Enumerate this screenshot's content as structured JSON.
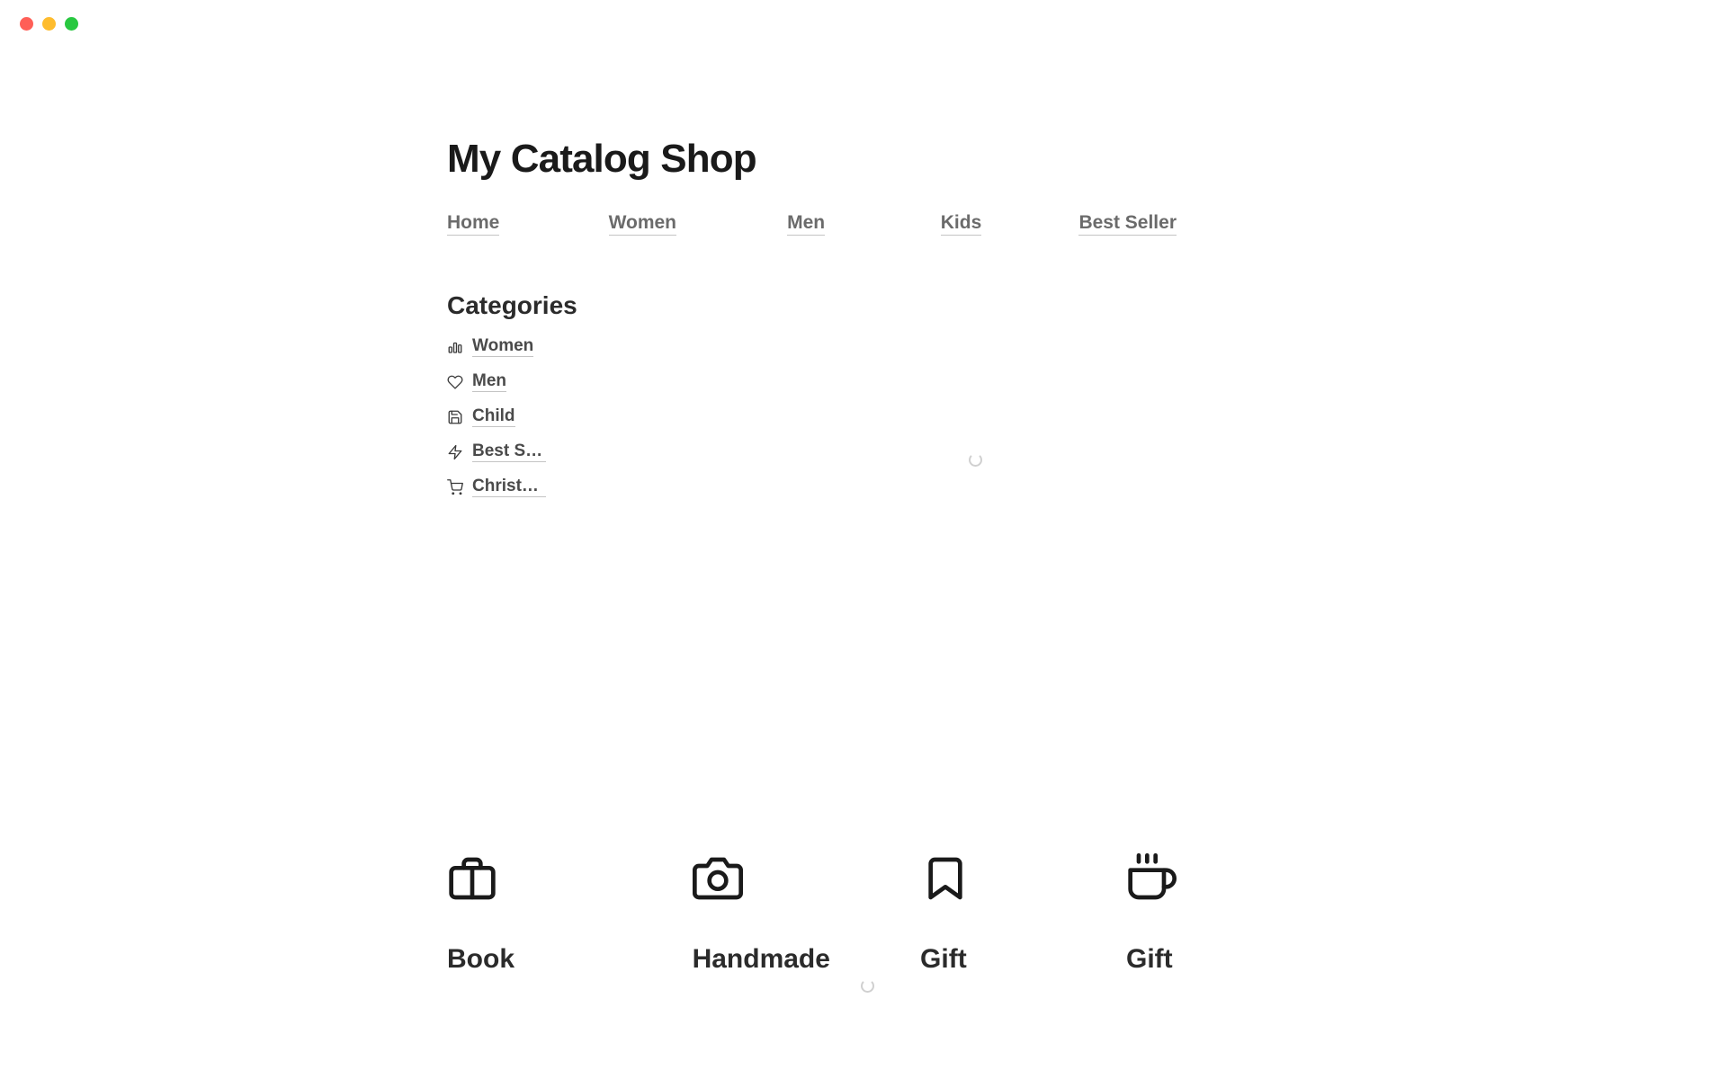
{
  "page": {
    "title": "My Catalog Shop"
  },
  "nav": {
    "items": [
      {
        "label": "Home"
      },
      {
        "label": "Women"
      },
      {
        "label": "Men"
      },
      {
        "label": "Kids"
      },
      {
        "label": "Best Seller"
      }
    ]
  },
  "categories": {
    "title": "Categories",
    "items": [
      {
        "label": "Women",
        "icon": "bar-chart"
      },
      {
        "label": "Men",
        "icon": "heart"
      },
      {
        "label": "Child",
        "icon": "save"
      },
      {
        "label": "Best Se…",
        "icon": "lightning"
      },
      {
        "label": "Christm…",
        "icon": "cart"
      }
    ]
  },
  "featured": {
    "items": [
      {
        "label": "Book",
        "icon": "briefcase"
      },
      {
        "label": "Handmade",
        "icon": "camera"
      },
      {
        "label": "Gift",
        "icon": "bookmark"
      },
      {
        "label": "Gift",
        "icon": "coffee"
      }
    ]
  }
}
